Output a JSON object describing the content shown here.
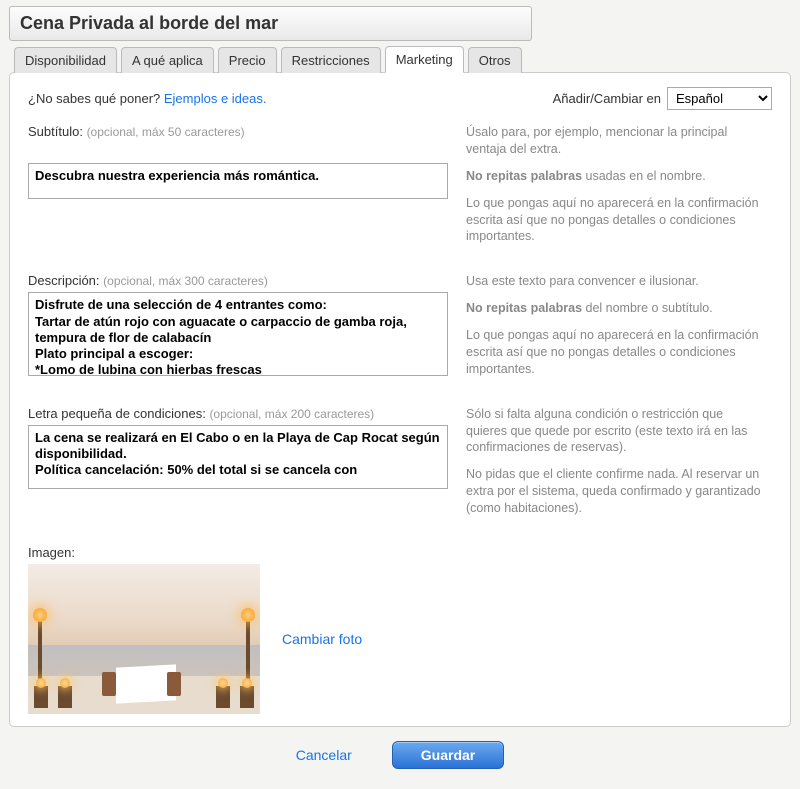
{
  "title": "Cena Privada al borde del mar",
  "tabs": {
    "availability": "Disponibilidad",
    "applies": "A qué aplica",
    "price": "Precio",
    "restrictions": "Restricciones",
    "marketing": "Marketing",
    "others": "Otros"
  },
  "prompt": {
    "q": "¿No sabes qué poner? ",
    "link": "Ejemplos e ideas."
  },
  "lang": {
    "label": "Añadir/Cambiar en",
    "selected": "Español"
  },
  "subtitle": {
    "label": "Subtítulo:",
    "hint": "(opcional, máx 50 caracteres)",
    "value": "Descubra nuestra experiencia más romántica.",
    "help1": "Úsalo para, por ejemplo, mencionar la principal ventaja del extra.",
    "help2_b": "No repitas palabras",
    "help2_r": " usadas en el nombre.",
    "help3": "Lo que pongas aquí no aparecerá en la confirmación escrita así que no pongas detalles o condiciones importantes."
  },
  "description": {
    "label": "Descripción:",
    "hint": "(opcional, máx 300 caracteres)",
    "value": "Disfrute de una selección de 4 entrantes como:\nTartar de atún rojo con aguacate o carpaccio de gamba roja, tempura de flor de calabacín\nPlato principal a escoger:\n*Lomo de lubina con hierbas frescas",
    "help1": "Usa este texto para convencer e ilusionar.",
    "help2_b": "No repitas palabras",
    "help2_r": " del nombre o subtítulo.",
    "help3": "Lo que pongas aquí no aparecerá en la confirmación escrita así que no pongas detalles o condiciones importantes."
  },
  "fineprint": {
    "label": "Letra pequeña de condiciones:",
    "hint": "(opcional, máx 200 caracteres)",
    "value": "La cena se realizará en El Cabo o en la Playa de Cap Rocat según disponibilidad.\nPolítica cancelación: 50% del total si se cancela con",
    "help1": "Sólo si falta alguna condición o restricción que quieres que quede por escrito (este texto irá en las confirmaciones de reservas).",
    "help2": "No pidas que el cliente confirme nada. Al reservar un extra por el sistema, queda confirmado y garantizado (como habitaciones)."
  },
  "image": {
    "label": "Imagen:",
    "change": "Cambiar foto"
  },
  "footer": {
    "cancel": "Cancelar",
    "save": "Guardar"
  }
}
